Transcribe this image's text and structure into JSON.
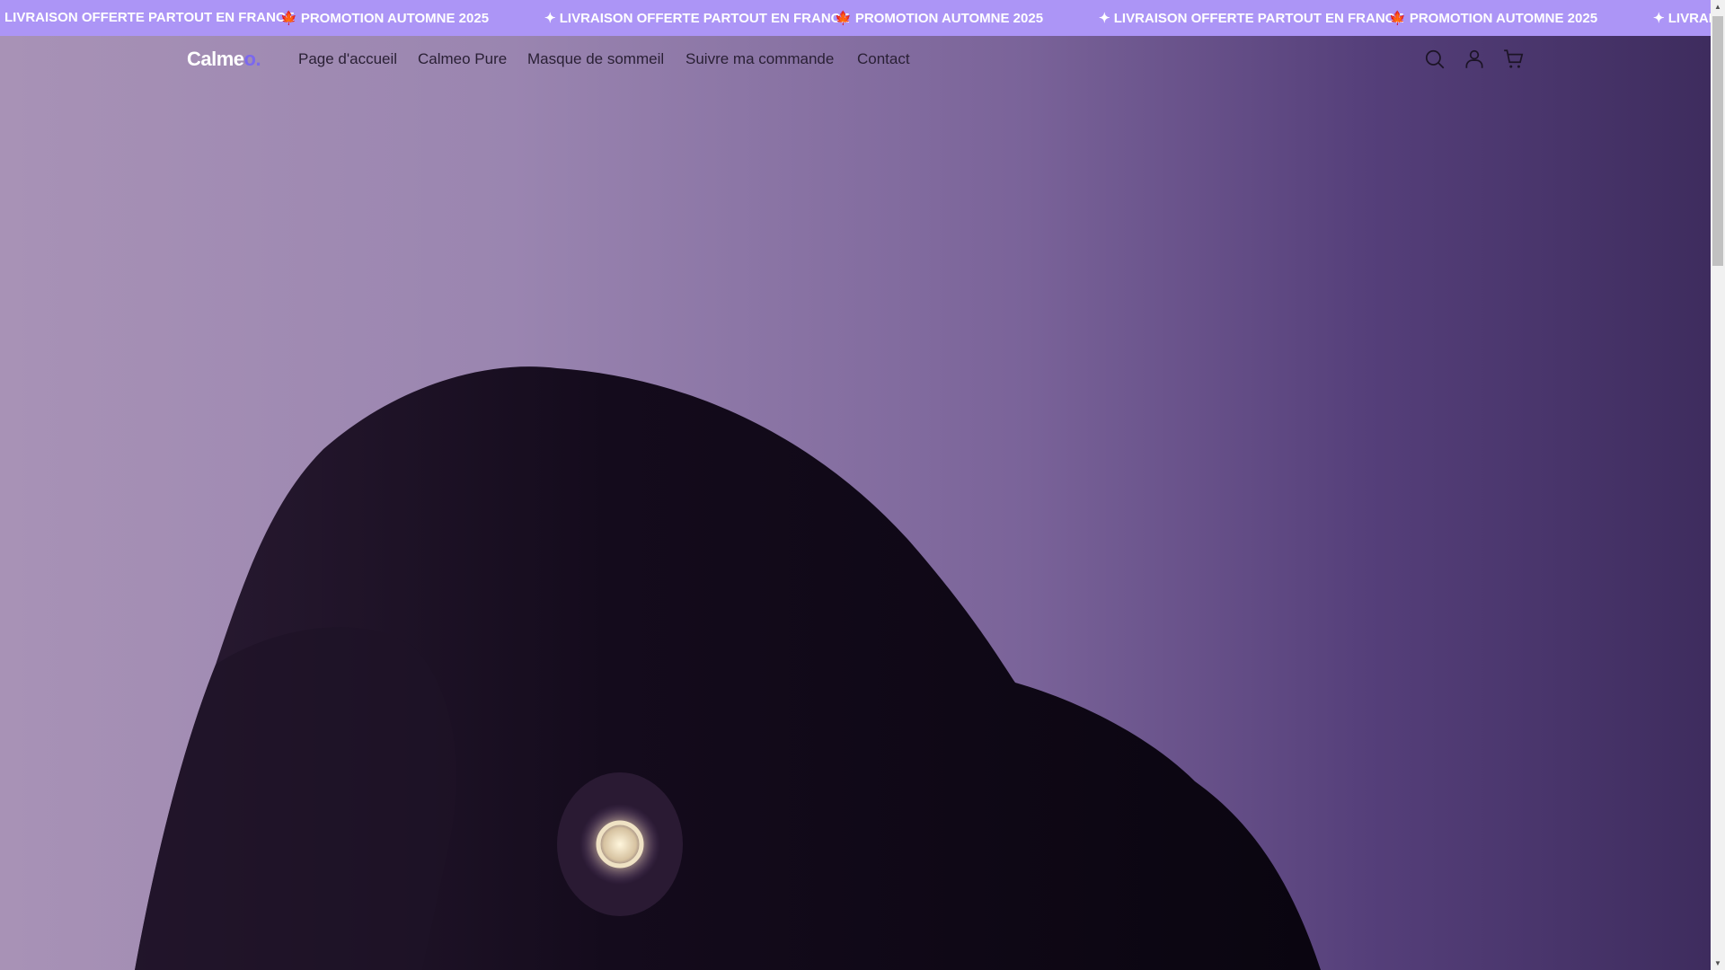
{
  "ticker": {
    "items": [
      "LIVRAISON OFFERTE PARTOUT EN FRANCE",
      "🍁 PROMOTION AUTOMNE 2025",
      "✦ LIVRAISON OFFERTE PARTOUT EN FRANCE",
      "🍁 PROMOTION AUTOMNE 2025",
      "✦ LIVRAISON OFFERTE PARTOUT EN FRANCE",
      "🍁 PROMOTION AUTOMNE 2025",
      "✦ LIVRAIS"
    ]
  },
  "header": {
    "logo": "Calme",
    "logo_dot": "o.",
    "nav": [
      "Page d'accueil",
      "Calmeo Pure",
      "Masque de sommeil",
      "Suivre ma commande",
      "Contact"
    ],
    "icons": [
      "search-icon",
      "account-icon",
      "cart-icon"
    ]
  },
  "colors": {
    "ticker_bg": "#ac95f6",
    "accent": "#7b68ee"
  }
}
